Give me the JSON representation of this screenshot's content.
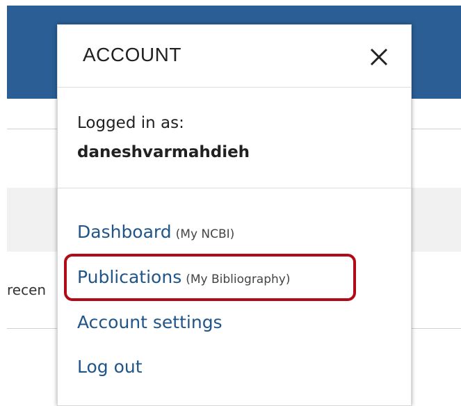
{
  "account_panel": {
    "title": "ACCOUNT",
    "close_icon": "close-icon",
    "logged_in_label": "Logged in as:",
    "username": "daneshvarmahdieh",
    "menu": [
      {
        "label": "Dashboard",
        "sub": "(My NCBI)"
      },
      {
        "label": "Publications",
        "sub": "(My Bibliography)"
      },
      {
        "label": "Account settings",
        "sub": ""
      },
      {
        "label": "Log out",
        "sub": ""
      }
    ]
  },
  "background": {
    "partial_text": "recen"
  },
  "colors": {
    "header_blue": "#2a5e94",
    "link_blue": "#20558a",
    "highlight_red": "#b00b17"
  }
}
